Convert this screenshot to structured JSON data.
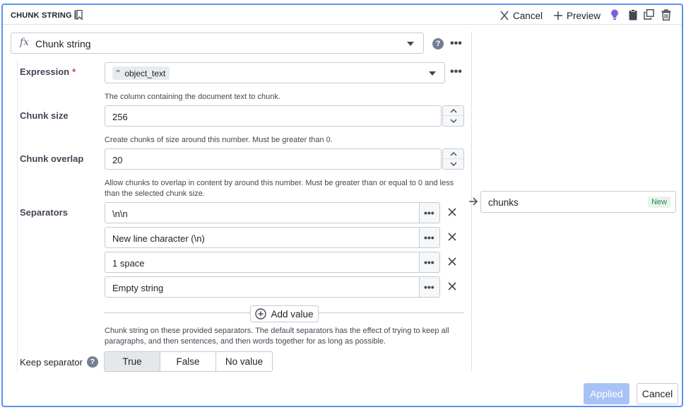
{
  "header": {
    "title": "CHUNK STRING",
    "cancel_label": "Cancel",
    "preview_label": "Preview"
  },
  "function_select": {
    "value": "Chunk string"
  },
  "expression": {
    "label": "Expression",
    "required_mark": "*",
    "value": "object_text",
    "helper": "The column containing the document text to chunk."
  },
  "chunk_size": {
    "label": "Chunk size",
    "value": "256",
    "helper": "Create chunks of size around this number. Must be greater than 0."
  },
  "chunk_overlap": {
    "label": "Chunk overlap",
    "value": "20",
    "helper": "Allow chunks to overlap in content by around this number. Must be greater than or equal to 0 and less than the selected chunk size."
  },
  "separators": {
    "label": "Separators",
    "items": [
      {
        "value": "\\n\\n"
      },
      {
        "value": "New line character (\\n)"
      },
      {
        "value": "1 space"
      },
      {
        "value": "Empty string"
      }
    ],
    "add_label": "Add value",
    "helper": "Chunk string on these provided separators. The default separators has the effect of trying to keep all paragraphs, and then sentences, and then words together for as long as possible."
  },
  "keep_separator": {
    "label": "Keep separator",
    "options": [
      "True",
      "False",
      "No value"
    ],
    "selected": "True"
  },
  "output": {
    "value": "chunks",
    "badge": "New"
  },
  "footer": {
    "apply_label": "Applied",
    "cancel_label": "Cancel"
  },
  "colors": {
    "accent": "#5e8ff0",
    "apply_disabled": "#a7c3f5",
    "required": "#cd4246",
    "new_badge": "#238551"
  }
}
